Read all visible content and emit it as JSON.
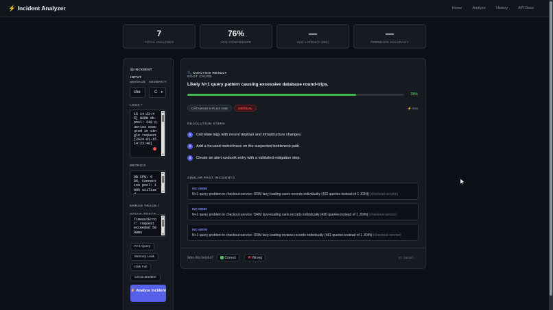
{
  "nav": {
    "brand": "Incident Analyzer",
    "links": [
      "Home",
      "Analyze",
      "History",
      "API Docs"
    ]
  },
  "stats": [
    {
      "value": "7",
      "label": "TOTAL ANALYSES"
    },
    {
      "value": "76%",
      "label": "AVG CONFIDENCE"
    },
    {
      "value": "—",
      "label": "AVG LATENCY (MS)"
    },
    {
      "value": "—",
      "label": "FEEDBACK ACCURACY"
    }
  ],
  "input": {
    "title": "INCIDENT INPUT",
    "service_label": "SERVICE",
    "service_value": "che",
    "severity_label": "SEVERITY",
    "severity_value": "C",
    "logs_label": "LOGS *",
    "logs_value": "15 14:23:45] WARN db-pool: 248 queries executed in single request [2024-01-15 14:23:46]",
    "metrics_label": "METRICS",
    "metrics_value": "DB CPU: 98%, Connection pool: 100% utilized",
    "trace_label": "ERROR TRACE / STACK TRACE",
    "trace_value": "TimeoutError: request exceeded 5000ms",
    "presets": [
      "N+1 Query",
      "Memory Leak",
      "Disk Full",
      "Circuit Breaker"
    ],
    "analyze_label": "Analyze Incident"
  },
  "result": {
    "title": "ANALYSIS RESULT",
    "root_cause_label": "ROOT CAUSE",
    "root_cause": "Likely N+1 query pattern causing excessive database round-trips.",
    "confidence": 78,
    "confidence_text": "78%",
    "category_tag": "DATABASE N PLUS ONE",
    "severity_tag": "CRITICAL",
    "latency": "0ms",
    "steps_label": "RESOLUTION STEPS",
    "steps": [
      "Correlate logs with recent deploys and infrastructure changes.",
      "Add a focused metric/trace on the suspected bottleneck path.",
      "Create an alert runbook entry with a validated mitigation step."
    ],
    "similar_label": "SIMILAR PAST INCIDENTS",
    "similar": [
      {
        "id": "INC-00858",
        "text": "N+1 query problem in checkout-service: ORM lazy-loading users records individually (432 queries instead of 1 JOIN)",
        "service": "(checkout-service)"
      },
      {
        "id": "INC-00590",
        "text": "N+1 query problem in checkout-service: ORM lazy-loading carts records individually (420 queries instead of 1 JOIN)",
        "service": "(checkout-service)"
      },
      {
        "id": "INC-00578",
        "text": "N+1 query problem in checkout-service: ORM lazy-loading reviews records individually (481 queries instead of 1 JOIN)",
        "service": "(checkout-service)"
      }
    ],
    "feedback_q": "Was this helpful?",
    "correct_label": "Correct",
    "wrong_label": "Wrong",
    "model_id": "ID: 1ae4ef..."
  },
  "colors": {
    "accent": "#5660e8",
    "success": "#3fb950",
    "critical": "#f85149"
  }
}
